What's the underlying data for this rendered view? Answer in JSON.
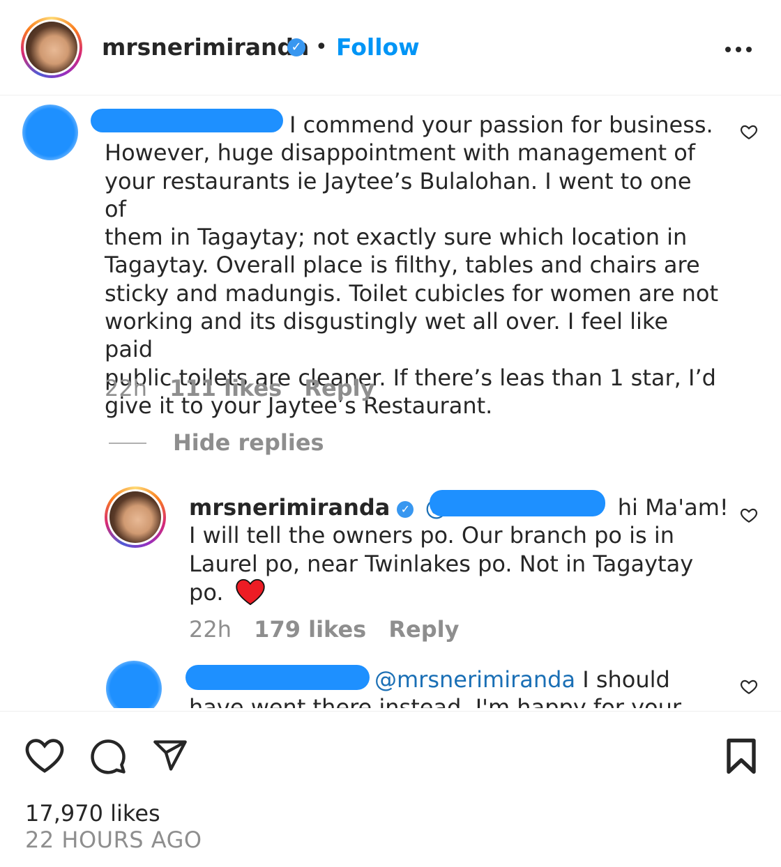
{
  "header": {
    "username": "mrsnerimiranda",
    "separator": "•",
    "follow_label": "Follow",
    "more_icon": "more-options-icon"
  },
  "comment": {
    "text_line1": "I commend your passion for business.",
    "text_rest": [
      "However, huge disappointment with management of",
      "your restaurants ie Jaytee’s Bulalohan. I went to one of",
      "them in Tagaytay; not exactly sure which location in",
      "Tagaytay. Overall place is filthy, tables and chairs are",
      "sticky and madungis. Toilet cubicles for women are not",
      "working and its disgustingly wet all over. I feel like paid",
      "public toilets are cleaner. If there’s leas than 1 star, I’d",
      "give it to your Jaytee’s Restaurant."
    ],
    "time": "22h",
    "likes": "111 likes",
    "reply_label": "Reply"
  },
  "hide_replies_label": "Hide replies",
  "reply1": {
    "username": "mrsnerimiranda",
    "mention_prefix": "@",
    "text_line1": "hi Ma'am!",
    "text_rest": [
      "I will tell the owners po. Our branch po is in",
      "Laurel po, near Twinlakes po. Not in Tagaytay"
    ],
    "text_last": "po.",
    "time": "22h",
    "likes": "179 likes",
    "reply_label": "Reply"
  },
  "reply2": {
    "mention": "@mrsnerimiranda",
    "text_line1": "I should",
    "text_line2": "have went there instead. I'm happy for your"
  },
  "footer": {
    "likes": "17,970 likes",
    "timestamp": "22 HOURS AGO"
  },
  "colors": {
    "link_blue": "#0095f6",
    "redaction_blue": "#1e90ff",
    "heart_red": "#ed1c24",
    "muted_gray": "#8e8e8e"
  }
}
